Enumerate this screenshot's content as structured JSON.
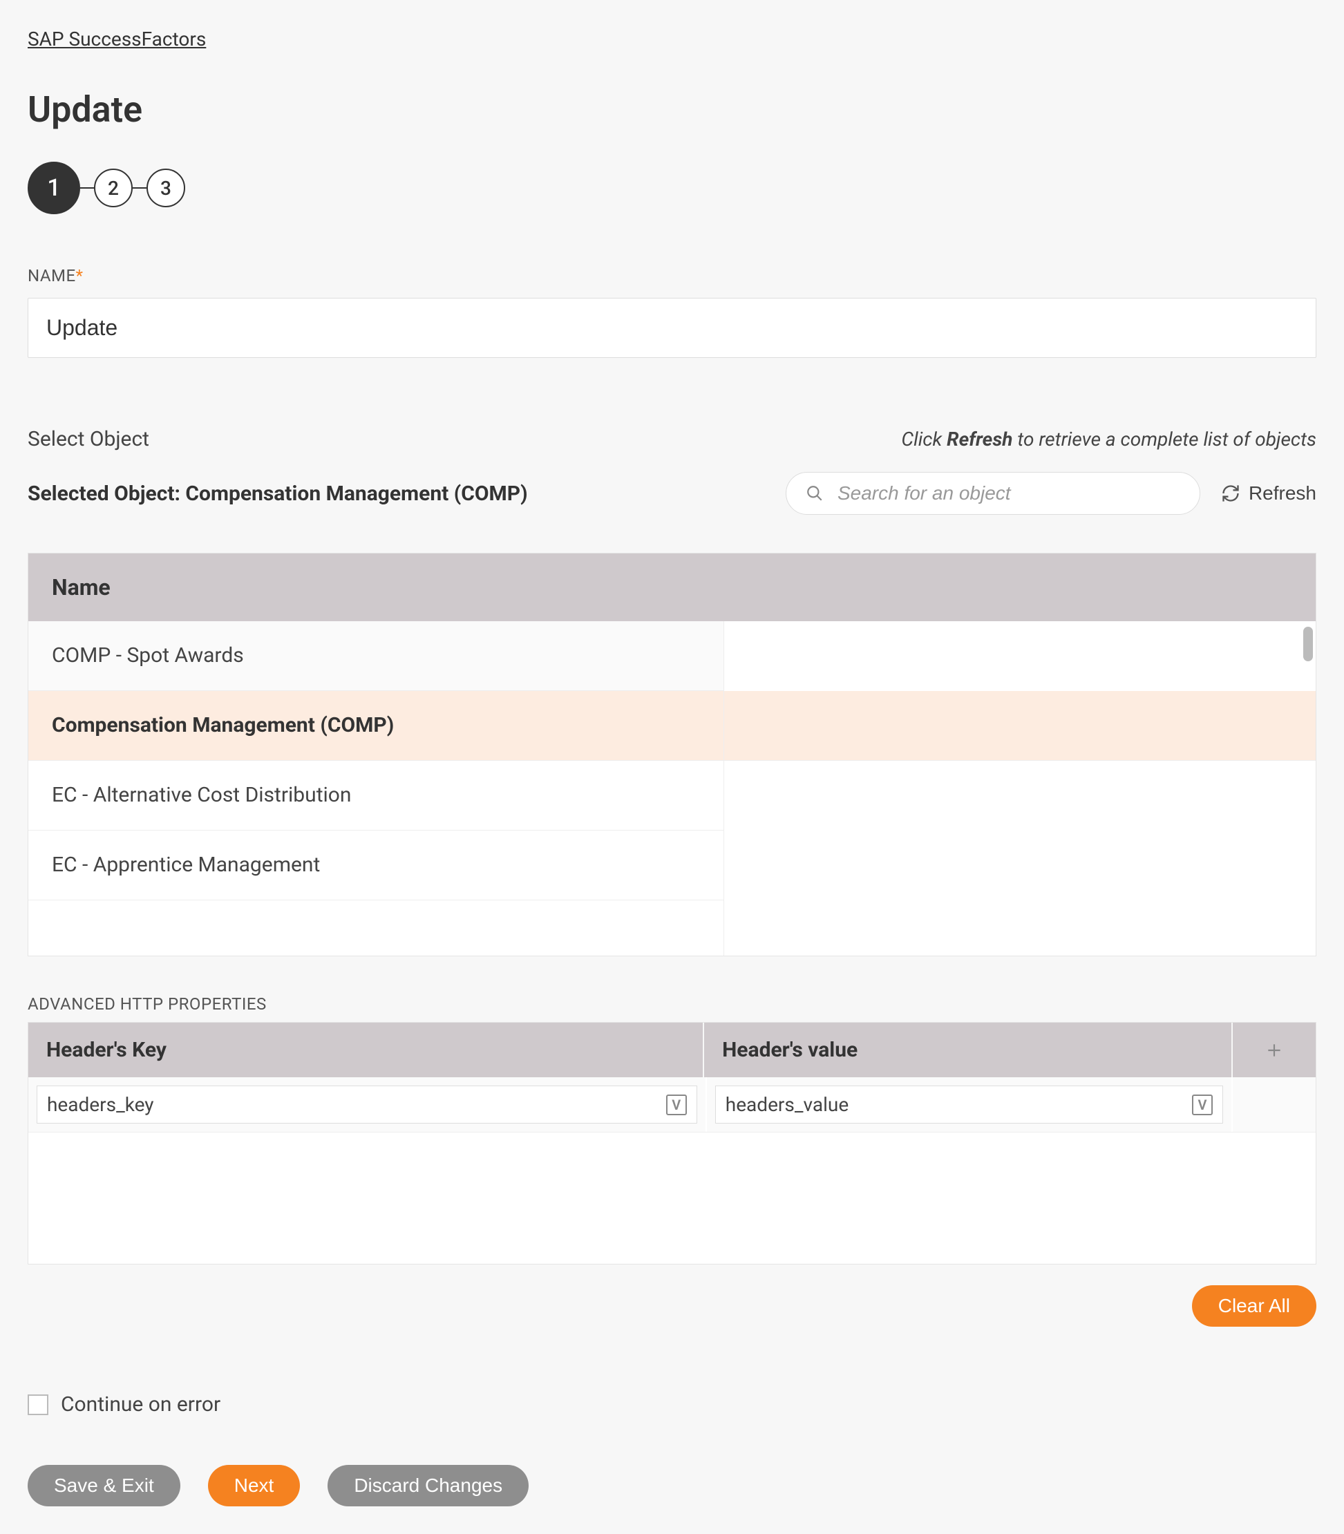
{
  "breadcrumb": "SAP SuccessFactors",
  "page_title": "Update",
  "stepper": {
    "s1": "1",
    "s2": "2",
    "s3": "3"
  },
  "name_field": {
    "label": "NAME",
    "value": "Update"
  },
  "select_object": {
    "label": "Select Object",
    "hint_prefix": "Click ",
    "hint_bold": "Refresh",
    "hint_suffix": " to retrieve a complete list of objects",
    "selected_label": "Selected Object: Compensation Management (COMP)",
    "search_placeholder": "Search for an object",
    "refresh_label": "Refresh"
  },
  "object_table": {
    "header": "Name",
    "rows": [
      {
        "name": "COMP - Spot Awards",
        "selected": false
      },
      {
        "name": "Compensation Management (COMP)",
        "selected": true
      },
      {
        "name": "EC - Alternative Cost Distribution",
        "selected": false
      },
      {
        "name": "EC - Apprentice Management",
        "selected": false
      }
    ]
  },
  "http": {
    "section_label": "ADVANCED HTTP PROPERTIES",
    "col_key": "Header's Key",
    "col_value": "Header's value",
    "row_key": "headers_key",
    "row_value": "headers_value",
    "clear_all": "Clear All"
  },
  "continue_on_error": "Continue on error",
  "buttons": {
    "save_exit": "Save & Exit",
    "next": "Next",
    "discard": "Discard Changes"
  }
}
